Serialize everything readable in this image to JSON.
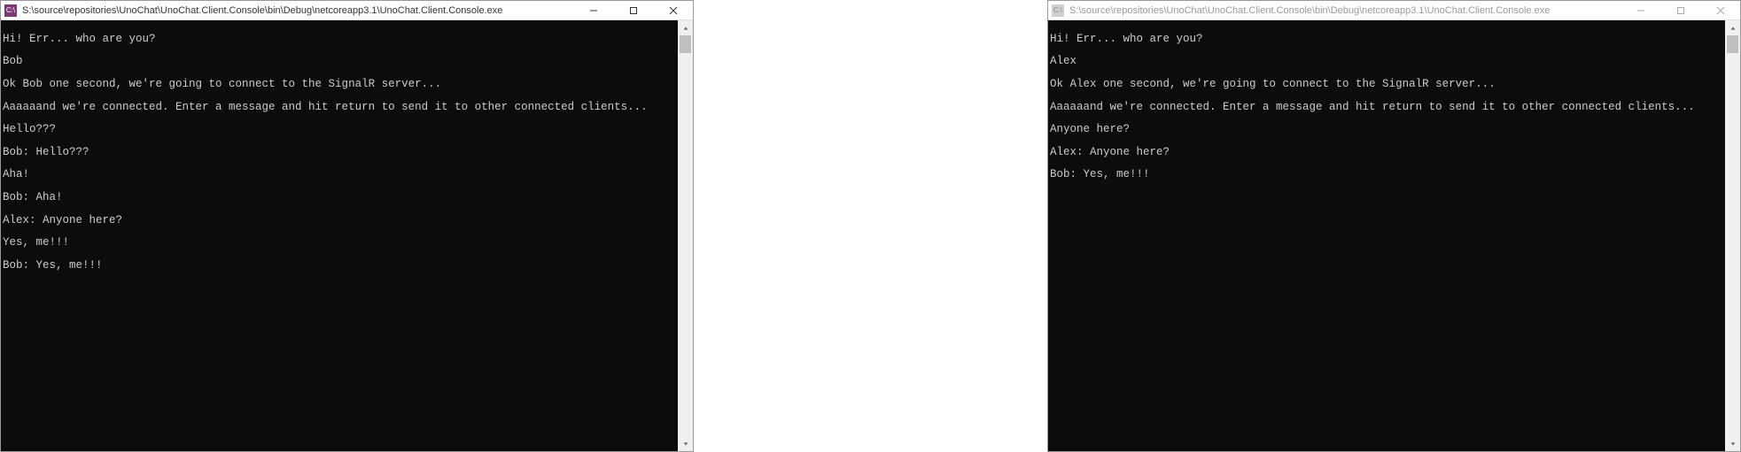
{
  "windows": [
    {
      "active": true,
      "icon_label": "C:\\",
      "title": "S:\\source\\repositories\\UnoChat\\UnoChat.Client.Console\\bin\\Debug\\netcoreapp3.1\\UnoChat.Client.Console.exe",
      "lines": [
        "Hi! Err... who are you?",
        "Bob",
        "Ok Bob one second, we're going to connect to the SignalR server...",
        "Aaaaaand we're connected. Enter a message and hit return to send it to other connected clients...",
        "Hello???",
        "Bob: Hello???",
        "Aha!",
        "Bob: Aha!",
        "Alex: Anyone here?",
        "Yes, me!!!",
        "Bob: Yes, me!!!"
      ]
    },
    {
      "active": false,
      "icon_label": "C:\\",
      "title": "S:\\source\\repositories\\UnoChat\\UnoChat.Client.Console\\bin\\Debug\\netcoreapp3.1\\UnoChat.Client.Console.exe",
      "lines": [
        "Hi! Err... who are you?",
        "Alex",
        "Ok Alex one second, we're going to connect to the SignalR server...",
        "Aaaaaand we're connected. Enter a message and hit return to send it to other connected clients...",
        "Anyone here?",
        "Alex: Anyone here?",
        "Bob: Yes, me!!!"
      ]
    }
  ]
}
